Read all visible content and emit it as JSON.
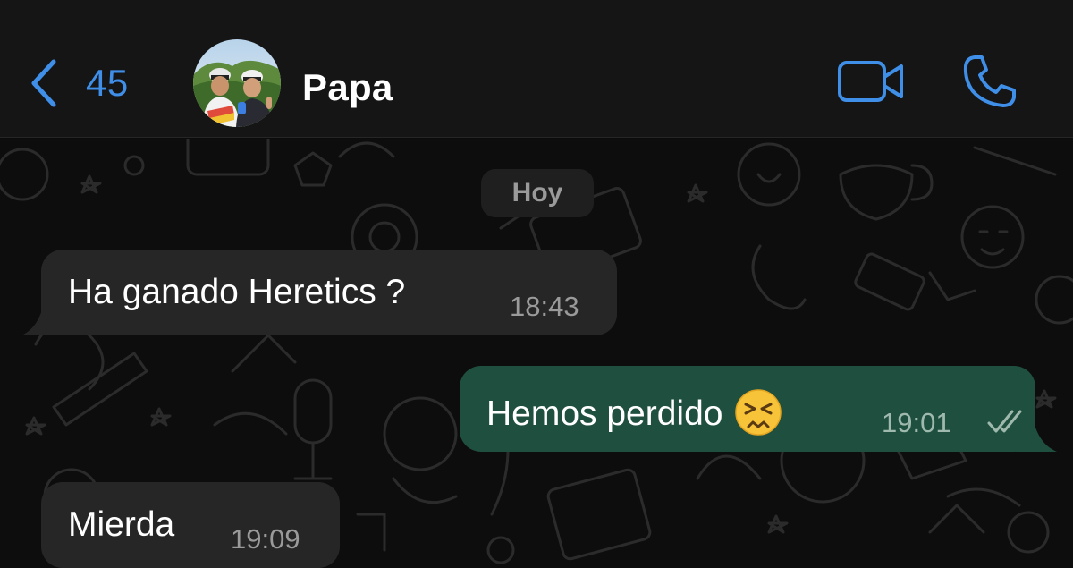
{
  "header": {
    "back_count": "45",
    "contact_name": "Papa",
    "icons": {
      "back": "chevron-left-icon",
      "video": "video-camera-icon",
      "call": "phone-icon"
    },
    "accent_color": "#3f8fe8"
  },
  "chat": {
    "date_chip": "Hoy",
    "messages": [
      {
        "direction": "incoming",
        "text": "Ha ganado Heretics ?",
        "time": "18:43"
      },
      {
        "direction": "outgoing",
        "text": "Hemos perdido",
        "emoji": "persevering-face",
        "time": "19:01",
        "status": "delivered-double-check"
      },
      {
        "direction": "incoming",
        "text": "Mierda",
        "time": "19:09"
      }
    ],
    "colors": {
      "incoming_bubble": "#262626",
      "outgoing_bubble": "#1f4f3f",
      "background": "#0d0d0d"
    }
  }
}
